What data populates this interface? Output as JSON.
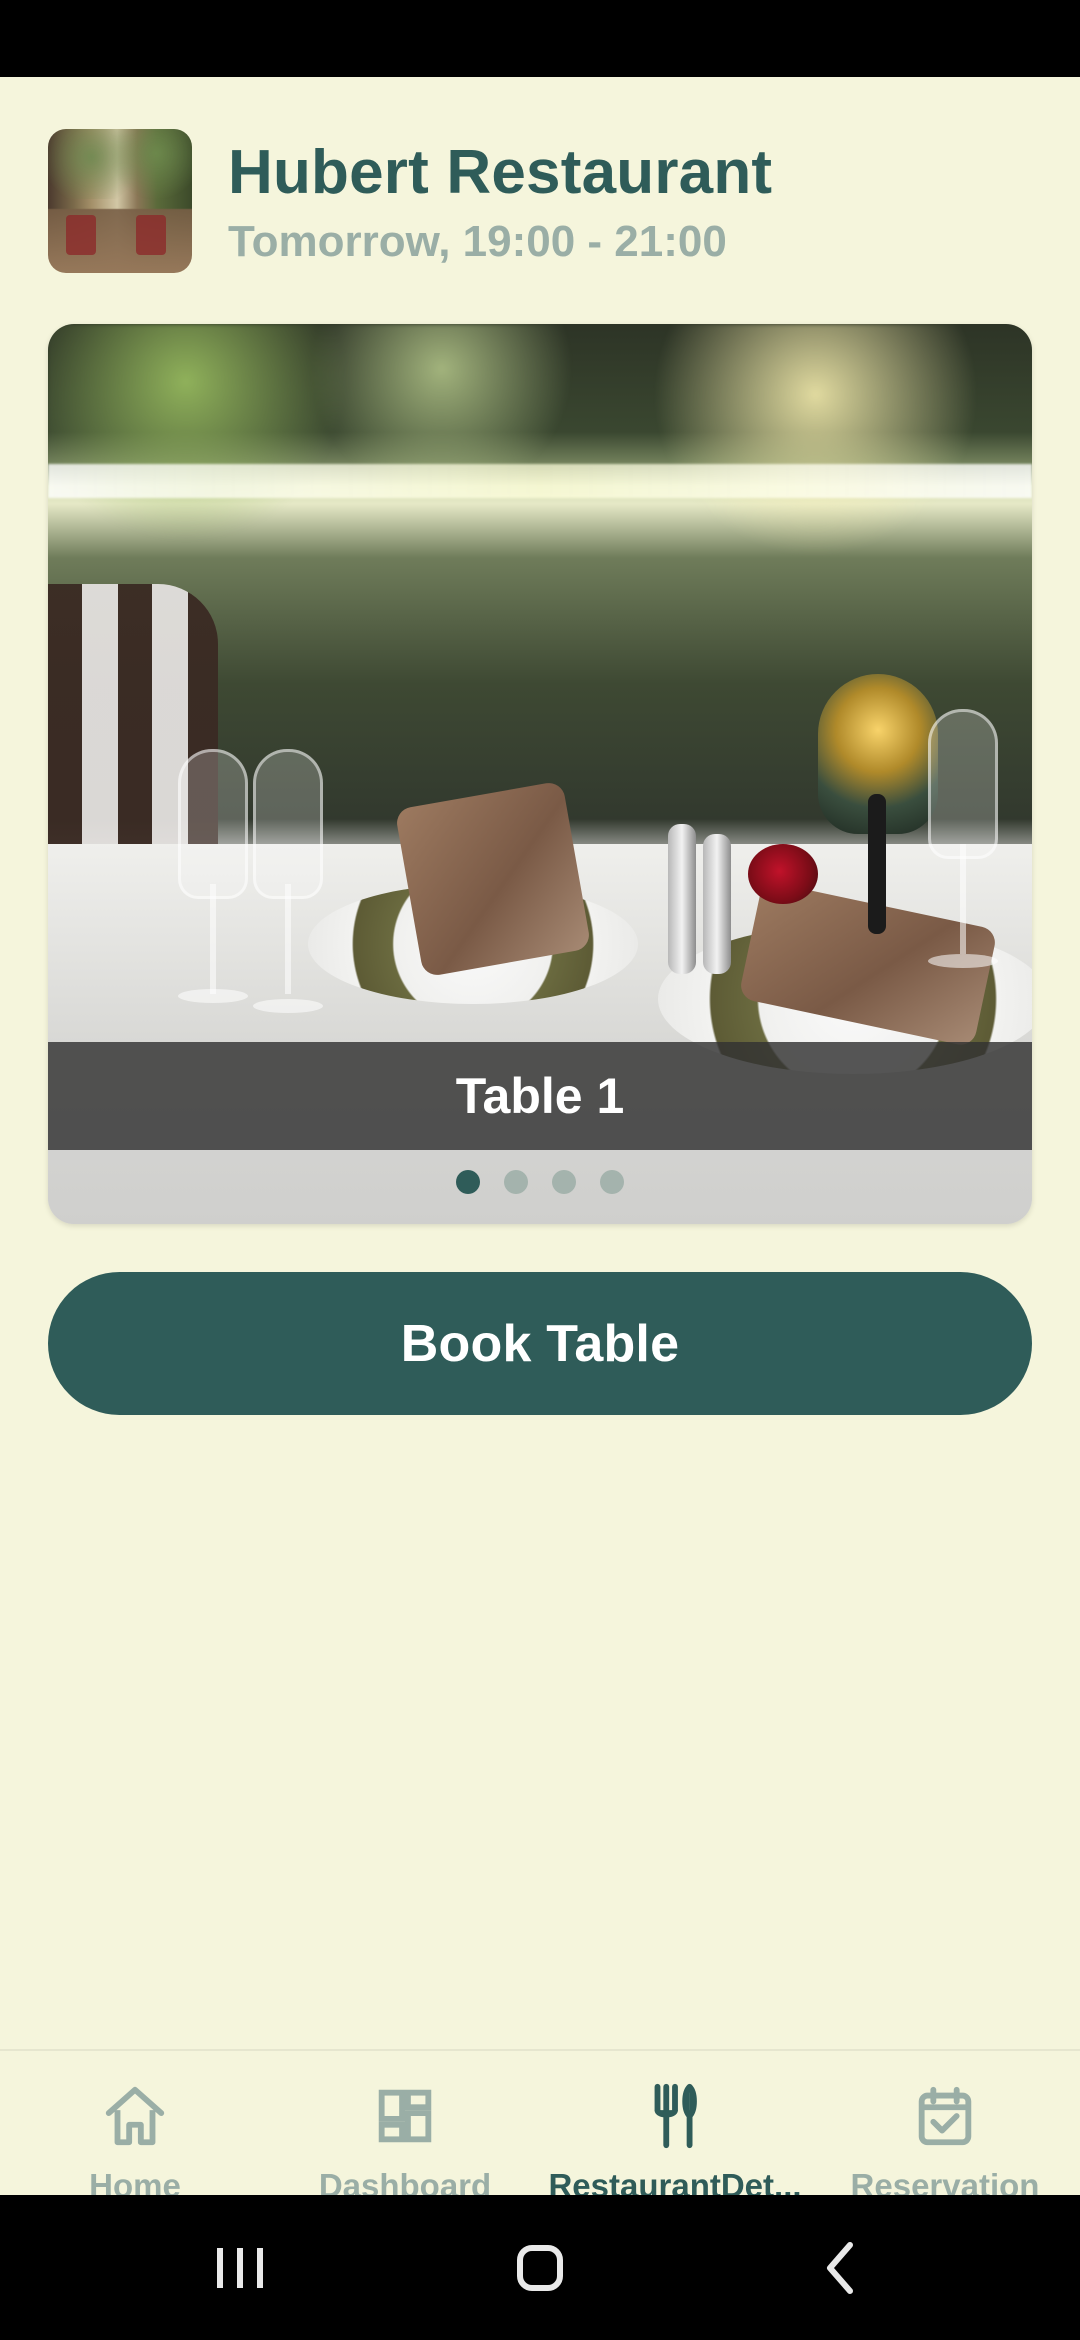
{
  "header": {
    "restaurant_name": "Hubert Restaurant",
    "reservation_time": "Tomorrow, 19:00 - 21:00"
  },
  "carousel": {
    "caption": "Table 1",
    "pager": {
      "total": 4,
      "active_index": 0
    }
  },
  "actions": {
    "book_button_label": "Book Table"
  },
  "bottom_nav": {
    "items": [
      {
        "label": "Home",
        "icon": "home-icon",
        "active": false
      },
      {
        "label": "Dashboard",
        "icon": "dashboard-icon",
        "active": false
      },
      {
        "label": "RestaurantDet...",
        "icon": "utensils-icon",
        "active": true
      },
      {
        "label": "Reservation",
        "icon": "calendar-check-icon",
        "active": false
      }
    ]
  },
  "colors": {
    "background": "#F5F5DC",
    "primary": "#2F5C59",
    "muted": "#9AAEA6",
    "caption_overlay": "#323232"
  },
  "system_nav": {
    "recent": "recent-apps-icon",
    "home": "home-square-icon",
    "back": "back-chevron-icon"
  }
}
